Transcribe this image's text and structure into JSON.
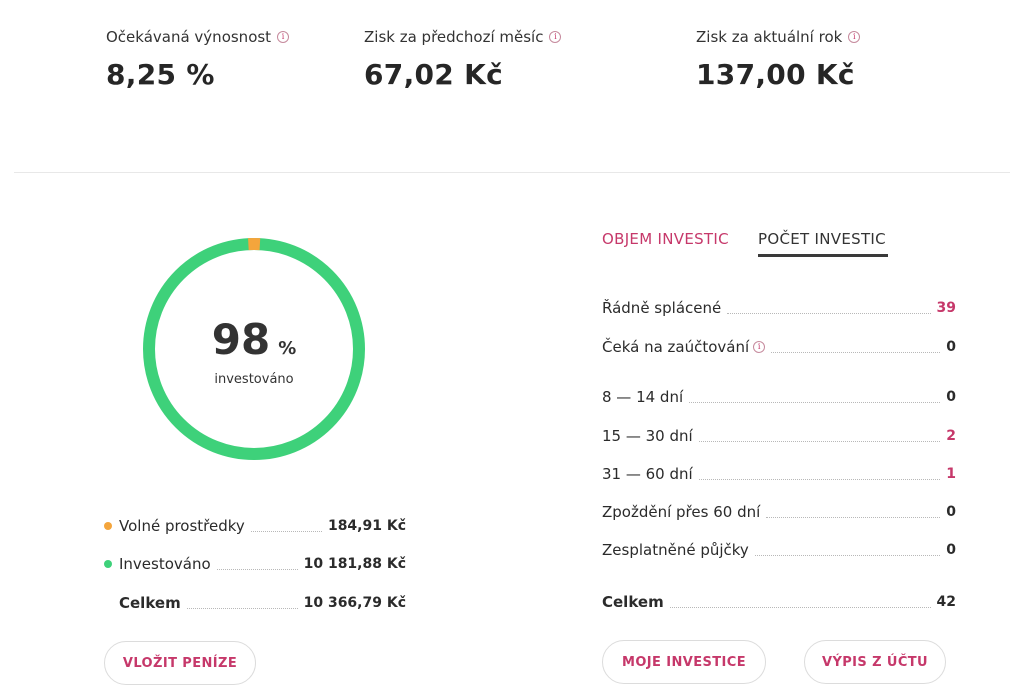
{
  "stats": [
    {
      "label": "Očekávaná výnosnost",
      "value": "8,25 %"
    },
    {
      "label": "Zisk za předchozí měsíc",
      "value": "67,02 Kč"
    },
    {
      "label": "Zisk za aktuální rok",
      "value": "137,00 Kč"
    }
  ],
  "donut": {
    "percent": "98",
    "unit": "%",
    "label": "investováno",
    "free_fraction": 0.018,
    "color_invested": "#3ed17a",
    "color_free": "#f4a53c"
  },
  "legend": {
    "free": {
      "label": "Volné prostředky",
      "value": "184,91 Kč",
      "color": "#f4a53c"
    },
    "invested": {
      "label": "Investováno",
      "value": "10 181,88 Kč",
      "color": "#3ed17a"
    },
    "total": {
      "label": "Celkem",
      "value": "10 366,79 Kč"
    }
  },
  "buttons": {
    "deposit": "VLOŽIT PENÍZE",
    "my_investments": "MOJE INVESTICE",
    "statement": "VÝPIS Z ÚČTU"
  },
  "tabs": {
    "volume": "OBJEM INVESTIC",
    "count": "POČET INVESTIC"
  },
  "rows": [
    {
      "label": "Řádně splácené",
      "value": "39"
    },
    {
      "label": "Čeká na zaúčtování",
      "value": "0"
    },
    {
      "label": "8 — 14 dní",
      "value": "0"
    },
    {
      "label": "15 — 30 dní",
      "value": "2"
    },
    {
      "label": "31 — 60 dní",
      "value": "1"
    },
    {
      "label": "Zpoždění přes 60 dní",
      "value": "0"
    },
    {
      "label": "Zesplatněné půjčky",
      "value": "0"
    },
    {
      "label": "Celkem",
      "value": "42"
    }
  ],
  "colors": {
    "accent": "#c6386a"
  }
}
